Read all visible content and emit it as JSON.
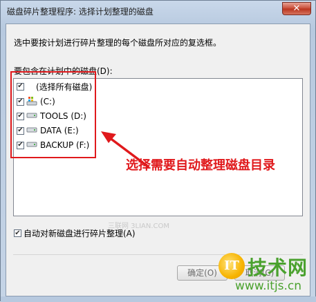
{
  "window": {
    "title": "磁盘碎片整理程序: 选择计划整理的磁盘",
    "close_label": "✕"
  },
  "dialog": {
    "instruction": "选中要按计划进行碎片整理的每个磁盘所对应的复选框。",
    "list_label": "要包含在计划中的磁盘(D):",
    "select_all": {
      "label": "(选择所有磁盘)",
      "checked": true
    },
    "drives": [
      {
        "label": "(C:)",
        "checked": true,
        "icon": "system-drive-icon"
      },
      {
        "label": "TOOLS (D:)",
        "checked": true,
        "icon": "hard-drive-icon"
      },
      {
        "label": "DATA (E:)",
        "checked": true,
        "icon": "hard-drive-icon"
      },
      {
        "label": "BACKUP (F:)",
        "checked": true,
        "icon": "hard-drive-icon"
      }
    ],
    "auto_defrag_label": "自动对新磁盘进行碎片整理(A)",
    "auto_defrag_checked": true,
    "ok_label": "确定(O)",
    "cancel_label": "取消(C)"
  },
  "annotation": {
    "text": "选择需要自动整理磁盘目录",
    "color": "#e0191c"
  },
  "watermarks": {
    "mid": "三联网 3LIAN.COM",
    "logo_badge": "IT",
    "logo_text": "技术网",
    "logo_url": "www.itjs.cn"
  },
  "colors": {
    "accent_green": "#4aa12e",
    "highlight_red": "#e0191c"
  }
}
